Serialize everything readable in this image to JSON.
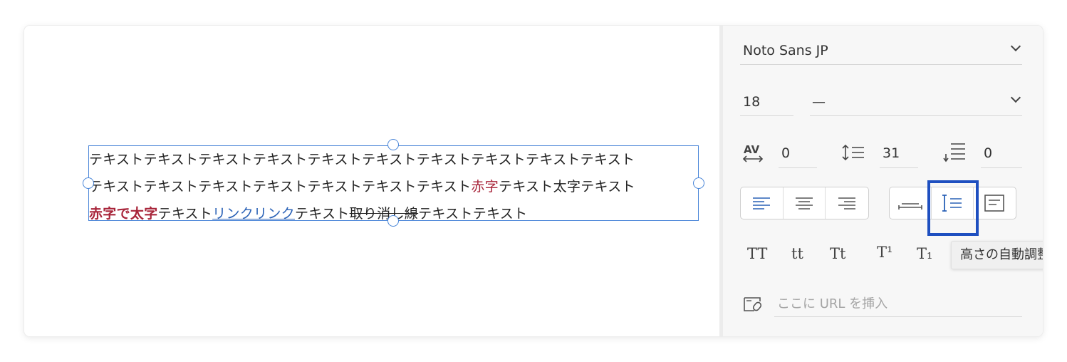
{
  "text_frame": {
    "line1": "テキストテキストテキストテキストテキストテキストテキストテキストテキストテキスト",
    "line2_a": "テキストテキストテキストテキストテキストテキストテキスト",
    "line2_red": "赤字",
    "line2_b": "テキスト太字テキスト",
    "line3_red_bold": "赤字で太字",
    "line3_a": "テキスト",
    "line3_link": "リンクリンク",
    "line3_b": "テキスト",
    "line3_strike": "取り消し線",
    "line3_c": "テキストテキスト"
  },
  "panel": {
    "font_family": "Noto Sans JP",
    "font_size": "18",
    "font_weight": "—",
    "letter_spacing": "0",
    "line_height": "31",
    "paragraph_spacing": "0",
    "case_buttons": [
      "TT",
      "tt",
      "Tt",
      "T¹",
      "T₁"
    ],
    "tooltip": "高さの自動調整",
    "url_placeholder": "ここに URL を挿入"
  },
  "colors": {
    "accent": "#2961b6",
    "red_text": "#a8253a",
    "selection": "#4a86d8",
    "highlight": "#1e4fc0"
  },
  "icons": [
    "letter-spacing-icon",
    "line-height-icon",
    "paragraph-spacing-icon",
    "align-left-icon",
    "align-center-icon",
    "align-right-icon",
    "auto-width-icon",
    "auto-height-icon",
    "fixed-size-icon",
    "link-icon",
    "chevron-down-icon"
  ]
}
